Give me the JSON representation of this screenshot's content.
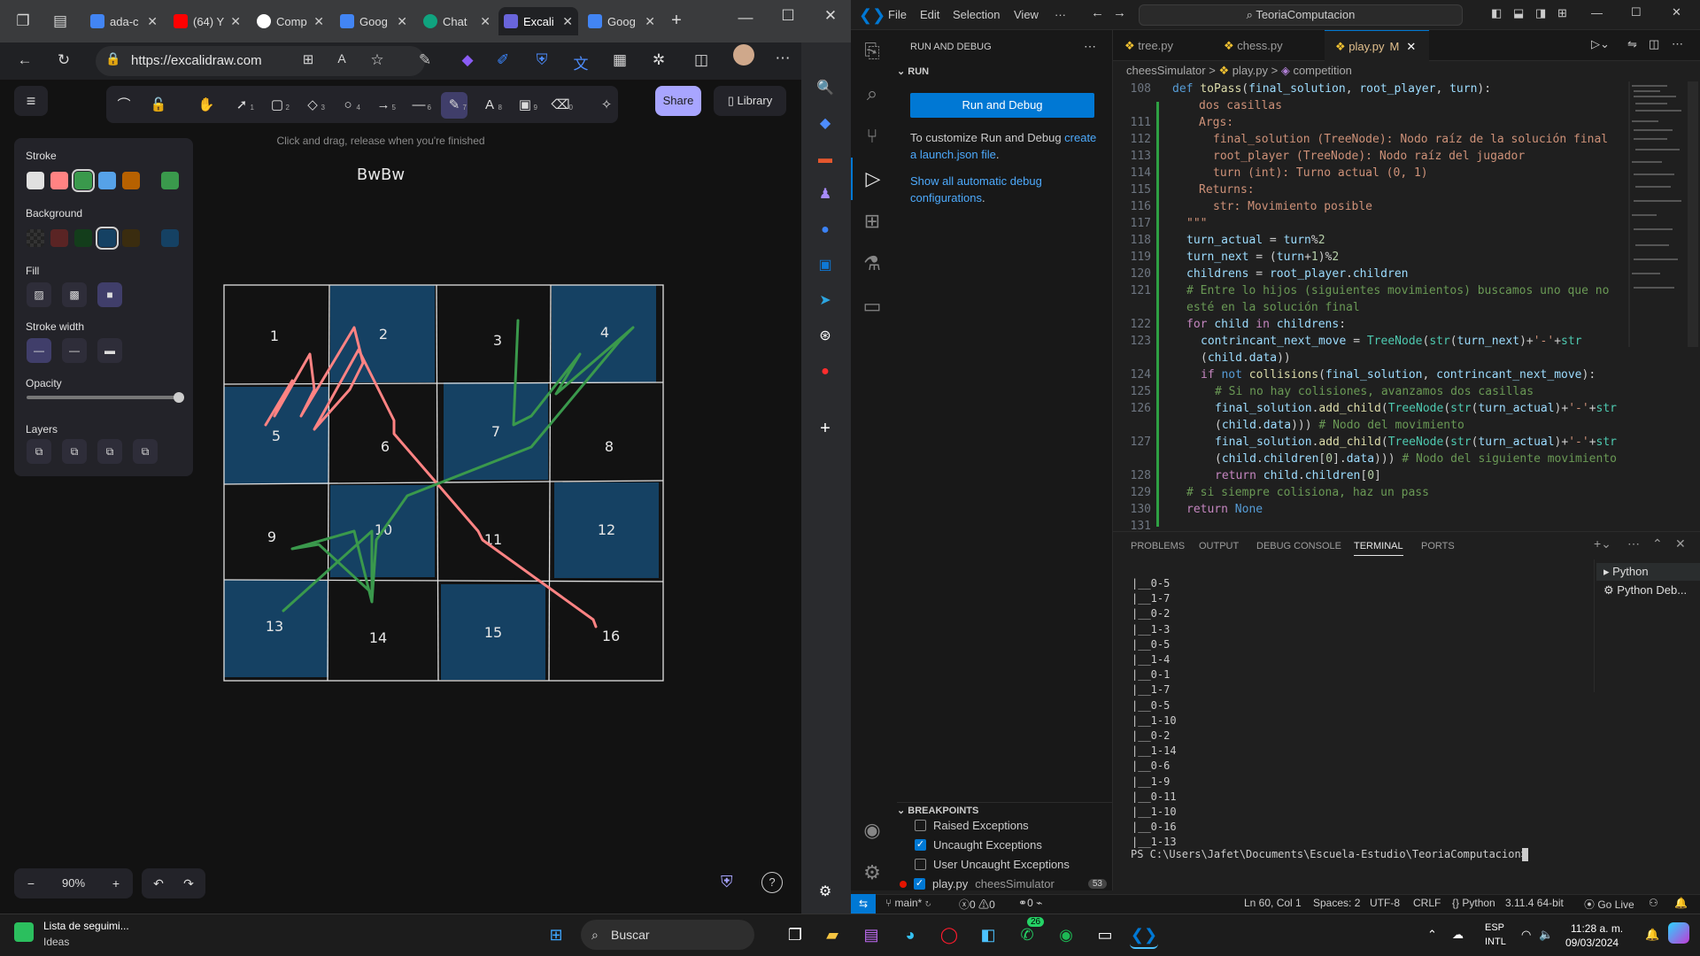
{
  "browser": {
    "tabs": [
      {
        "label": "ada-c",
        "color": "#4285f4"
      },
      {
        "label": "(64) Y",
        "color": "#ff0000"
      },
      {
        "label": "Comp",
        "color": "#ffffff"
      },
      {
        "label": "Goog",
        "color": "#4285f4"
      },
      {
        "label": "Chat",
        "color": "#10a37f"
      },
      {
        "label": "Excali",
        "color": "#6965db"
      },
      {
        "label": "Goog",
        "color": "#4285f4"
      }
    ],
    "url": "https://excalidraw.com"
  },
  "excalidraw": {
    "share": "Share",
    "library": "Library",
    "hint": "Click and drag, release when you're finished",
    "title_text": "BwBw",
    "tool_shortcuts": [
      "1",
      "2",
      "3",
      "4",
      "5",
      "6",
      "7",
      "8",
      "9",
      "0"
    ],
    "panel": {
      "stroke": "Stroke",
      "background": "Background",
      "fill": "Fill",
      "stroke_width": "Stroke width",
      "opacity": "Opacity",
      "layers": "Layers"
    },
    "stroke_colors": [
      "#e0e0e0",
      "#ff8383",
      "#3a994c",
      "#56a2e8",
      "#b76100",
      "#3a994c"
    ],
    "bg_colors": [
      "#2e2e2e",
      "#5a2424",
      "#133d1b",
      "#154163",
      "#3a2c0f",
      "#154163"
    ],
    "zoom": "90%",
    "grid_numbers": [
      "1",
      "2",
      "3",
      "4",
      "5",
      "6",
      "7",
      "8",
      "9",
      "10",
      "11",
      "12",
      "13",
      "14",
      "15",
      "16"
    ],
    "dark_cell_color": "#154163",
    "accent": "#a8a5ff"
  },
  "vscode": {
    "menu": [
      "File",
      "Edit",
      "Selection",
      "View",
      "···"
    ],
    "search": "TeoriaComputacion",
    "sidebar": {
      "title": "RUN AND DEBUG",
      "section": "RUN",
      "run_button": "Run and Debug",
      "customize_pre": "To customize Run and Debug ",
      "customize_link": "create a launch.json file",
      "customize_post": ".",
      "show_all": "Show all automatic debug configurations",
      "show_all_post": ".",
      "breakpoints_title": "BREAKPOINTS",
      "breakpoints": [
        {
          "label": "Raised Exceptions",
          "checked": false
        },
        {
          "label": "Uncaught Exceptions",
          "checked": true
        },
        {
          "label": "User Uncaught Exceptions",
          "checked": false
        },
        {
          "label": "play.py",
          "extra": "cheesSimulator",
          "count": "53",
          "checked": true
        }
      ]
    },
    "tabs": [
      {
        "label": "tree.py"
      },
      {
        "label": "chess.py"
      },
      {
        "label": "play.py",
        "modified": "M"
      }
    ],
    "breadcrumbs": [
      "cheesSimulator",
      ">",
      "play.py",
      ">",
      "competition"
    ],
    "line_numbers": [
      "108",
      "",
      "111",
      "112",
      "113",
      "114",
      "115",
      "116",
      "117",
      "118",
      "119",
      "120",
      "121",
      "",
      "122",
      "123",
      "",
      "124",
      "125",
      "126",
      "",
      "127",
      "",
      "128",
      "129",
      "130",
      "131"
    ],
    "panel_tabs": [
      "PROBLEMS",
      "OUTPUT",
      "DEBUG CONSOLE",
      "TERMINAL",
      "PORTS"
    ],
    "terminal_lines": [
      "|__0-5",
      "|__1-7",
      "|__0-2",
      "|__1-3",
      "|__0-5",
      "|__1-4",
      "|__0-1",
      "|__1-7",
      "|__0-5",
      "|__1-10",
      "|__0-2",
      "|__1-14",
      "|__0-6",
      "|__1-9",
      "|__0-11",
      "|__1-10",
      "|__0-16",
      "|__1-13"
    ],
    "prompt": "PS C:\\Users\\Jafet\\Documents\\Escuela-Estudio\\TeoriaComputacion> ",
    "terminals": [
      "Python",
      "Python Deb..."
    ],
    "status": {
      "branch": "main*",
      "errors": "0",
      "warnings": "0",
      "ports": "0",
      "position": "Ln 60, Col 1",
      "spaces": "Spaces: 2",
      "encoding": "UTF-8",
      "eol": "CRLF",
      "language": "Python",
      "interpreter": "3.11.4 64-bit",
      "golive": "Go Live"
    }
  },
  "taskbar": {
    "widget_title": "Lista de seguimi...",
    "widget_sub": "Ideas",
    "search": "Buscar",
    "lang1": "ESP",
    "lang2": "INTL",
    "time": "11:28 a. m.",
    "date": "09/03/2024",
    "whatsapp_badge": "26"
  }
}
